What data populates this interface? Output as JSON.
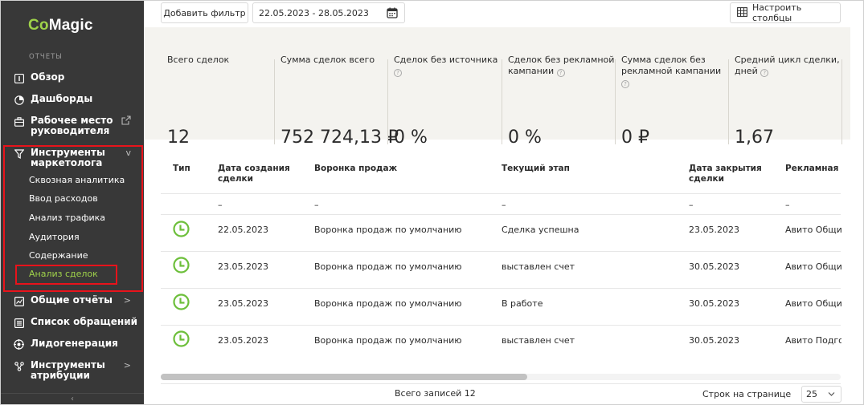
{
  "sidebar": {
    "logo_prefix": "Co",
    "logo_suffix": "Magic",
    "section": "ОТЧЕТЫ",
    "items": {
      "overview": "Обзор",
      "dashboards": "Дашборды",
      "workplace_l1": "Рабочее место",
      "workplace_l2": "руководителя",
      "marketer_l1": "Инструменты",
      "marketer_l2": "маркетолога",
      "general": "Общие отчёты",
      "requests": "Список обращений",
      "leadgen": "Лидогенерация",
      "attrib_l1": "Инструменты",
      "attrib_l2": "атрибуции"
    },
    "submenu": {
      "through": "Сквозная аналитика",
      "costs": "Ввод расходов",
      "traffic": "Анализ трафика",
      "audience": "Аудитория",
      "content": "Содержание",
      "deals": "Анализ сделок"
    },
    "chevron_down": "v",
    "chevron_right": ">",
    "collapse": "‹"
  },
  "toolbar": {
    "filter_label": "Добавить фильтр",
    "date_range": "22.05.2023 - 28.05.2023",
    "columns_label": "Настроить столбцы"
  },
  "stats": [
    {
      "l1": "Всего сделок",
      "l2": "",
      "l3": "",
      "q": "",
      "value": "12"
    },
    {
      "l1": "Сумма сделок всего",
      "l2": "",
      "l3": "",
      "q": "",
      "value": "752 724,13 ₽"
    },
    {
      "l1": "Сделок без источника",
      "l2": "",
      "l3": "",
      "q": "?",
      "value": "0 %"
    },
    {
      "l1": "Сделок без рекламной",
      "l2": "кампании",
      "l3": "",
      "q": "?",
      "value": "0 %"
    },
    {
      "l1": "Сумма сделок без",
      "l2": "рекламной кампании",
      "l3": "",
      "q": "?",
      "value": "0 ₽"
    },
    {
      "l1": "Средний цикл сделки,",
      "l2": "дней",
      "l3": "",
      "q": "?",
      "value": "1,67"
    }
  ],
  "table": {
    "headers": {
      "type": "Тип",
      "created_l1": "Дата создания",
      "created_l2": "сделки",
      "funnel": "Воронка продаж",
      "stage": "Текущий этап",
      "closed_l1": "Дата закрытия",
      "closed_l2": "сделки",
      "campaign": "Рекламная ка"
    },
    "dash": "–",
    "rows": [
      {
        "created": "22.05.2023",
        "funnel": "Воронка продаж по умолчанию",
        "stage": "Сделка успешна",
        "closed": "23.05.2023",
        "campaign": "Авито Общий"
      },
      {
        "created": "23.05.2023",
        "funnel": "Воронка продаж по умолчанию",
        "stage": "выставлен счет",
        "closed": "30.05.2023",
        "campaign": "Авито Общий"
      },
      {
        "created": "23.05.2023",
        "funnel": "Воронка продаж по умолчанию",
        "stage": "В работе",
        "closed": "30.05.2023",
        "campaign": "Авито Общий"
      },
      {
        "created": "23.05.2023",
        "funnel": "Воронка продаж по умолчанию",
        "stage": "выставлен счет",
        "closed": "30.05.2023",
        "campaign": "Авито Подгор"
      }
    ]
  },
  "footer": {
    "total": "Всего записей 12",
    "per_page_label": "Строк на странице",
    "per_page_value": "25"
  },
  "colors": {
    "sidebar_bg": "#383838",
    "accent_green": "#9fd24a",
    "highlight_red": "#e8131b",
    "stats_bg": "#f4f3ef",
    "status_green": "#6dbf3b"
  }
}
